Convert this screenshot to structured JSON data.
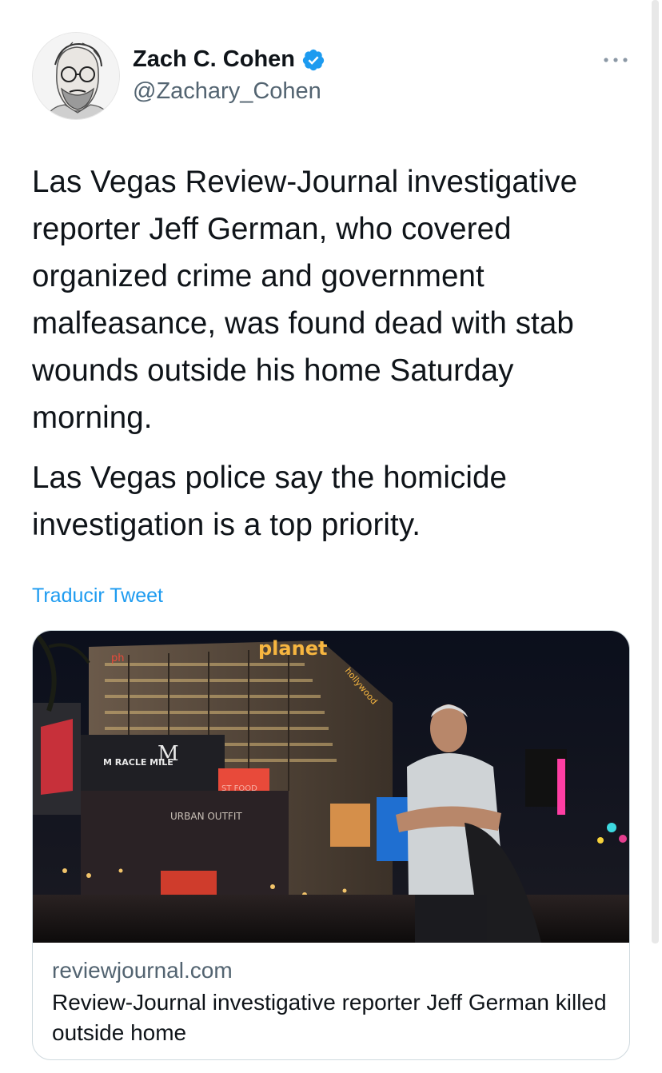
{
  "author": {
    "name": "Zach C. Cohen",
    "handle": "@Zachary_Cohen",
    "verified": true,
    "avatar_icon": "avatar-portrait-sketch"
  },
  "tweet": {
    "paragraphs": [
      "Las Vegas Review-Journal investigative reporter Jeff German, who covered organized crime and government malfeasance, was found dead with stab wounds outside his home Saturday morning.",
      "Las Vegas police say the homicide investigation is a top priority."
    ],
    "translate_label": "Traducir Tweet"
  },
  "card": {
    "domain": "reviewjournal.com",
    "title": "Review-Journal investigative reporter Jeff German killed outside home",
    "image_icon": "photo-man-in-front-of-casinos",
    "image_signage": {
      "planet": "planet",
      "hollywood": "hollywood",
      "ph": "ph",
      "miracle_mile": "M RACLE MILE",
      "urban_outfit": "URBAN OUTFIT",
      "stfood": "ST FOOD"
    }
  },
  "colors": {
    "accent": "#1d9bf0",
    "secondary_text": "#536471",
    "border": "#cfd9de"
  }
}
